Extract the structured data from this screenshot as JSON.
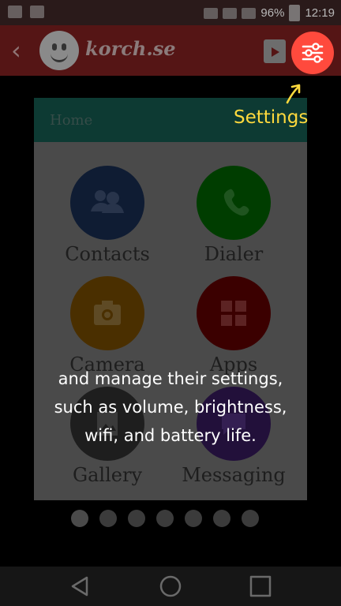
{
  "status_bar": {
    "battery": "96%",
    "time": "12:19"
  },
  "app_bar": {
    "back": "‹",
    "title": "korch.se"
  },
  "home_panel": {
    "header": "Home",
    "apps": [
      {
        "label": "Contacts",
        "color": "#0f1c33"
      },
      {
        "label": "Dialer",
        "color": "#003d00"
      },
      {
        "label": "Camera",
        "color": "#4a2f00"
      },
      {
        "label": "Apps",
        "color": "#3b0000"
      },
      {
        "label": "Gallery",
        "color": "#1e1e1e"
      },
      {
        "label": "Messaging",
        "color": "#22103a"
      }
    ],
    "page_dots": 7,
    "active_dot": 0
  },
  "tutorial": {
    "pointer_label": "Settings",
    "message_lines": [
      "and manage their settings,",
      "such as volume, brightness,",
      "wifi, and battery life."
    ]
  },
  "colors": {
    "accent": "#ff4a3d",
    "hint": "#ffd93d"
  }
}
